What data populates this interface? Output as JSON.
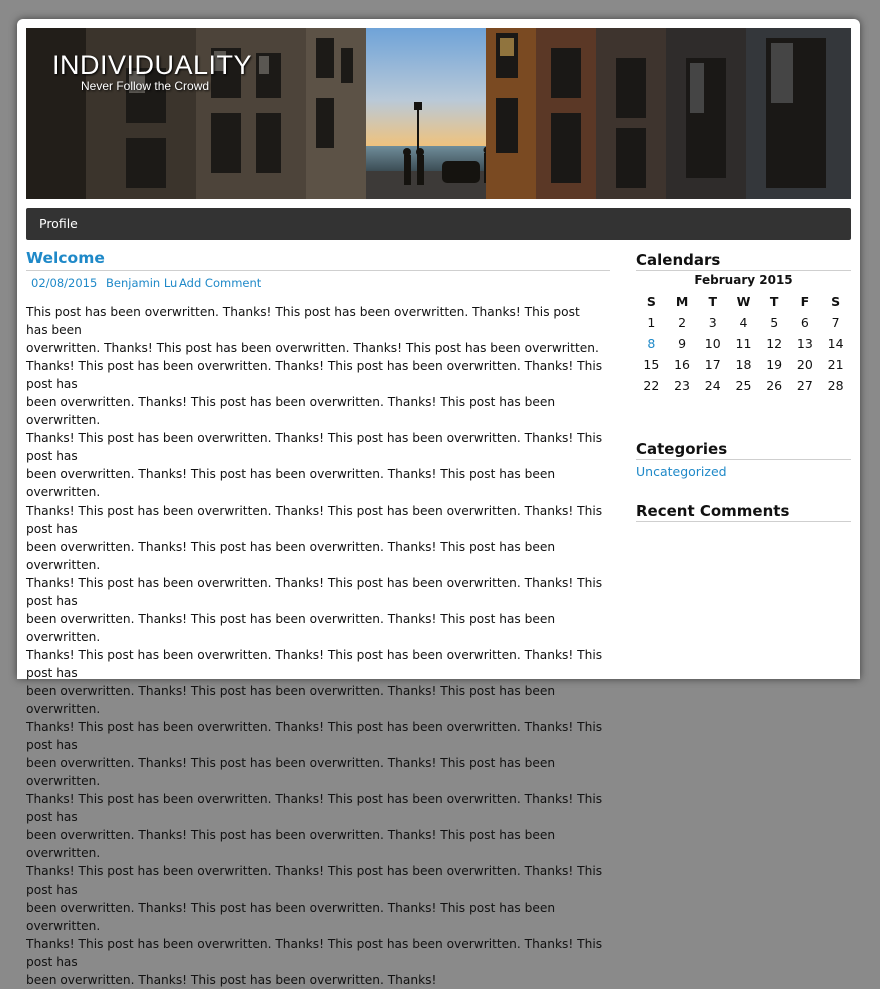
{
  "site": {
    "title": "INDIVIDUALITY",
    "tagline": "Never Follow the Crowd"
  },
  "nav": {
    "items": [
      {
        "label": "Profile"
      }
    ]
  },
  "post": {
    "title": "Welcome",
    "date": "02/08/2015",
    "author": "Benjamin Lu",
    "comment_link": "Add Comment",
    "lines": [
      "This post has been overwritten. Thanks! This post has been overwritten. Thanks! This post has been",
      "overwritten. Thanks! This post has been overwritten. Thanks! This post has been overwritten.",
      "Thanks! This post has been overwritten. Thanks! This post has been overwritten. Thanks! This post has",
      "been overwritten. Thanks! This post has been overwritten. Thanks! This post has been overwritten.",
      "Thanks! This post has been overwritten. Thanks! This post has been overwritten. Thanks! This post has",
      "been overwritten. Thanks! This post has been overwritten. Thanks! This post has been overwritten.",
      "Thanks! This post has been overwritten. Thanks! This post has been overwritten. Thanks! This post has",
      "been overwritten. Thanks! This post has been overwritten. Thanks! This post has been overwritten.",
      "Thanks! This post has been overwritten. Thanks! This post has been overwritten. Thanks! This post has",
      "been overwritten. Thanks! This post has been overwritten. Thanks! This post has been overwritten.",
      "Thanks! This post has been overwritten. Thanks! This post has been overwritten. Thanks! This post has",
      "been overwritten. Thanks! This post has been overwritten. Thanks! This post has been overwritten.",
      "Thanks! This post has been overwritten. Thanks! This post has been overwritten. Thanks! This post has",
      "been overwritten. Thanks! This post has been overwritten. Thanks! This post has been overwritten.",
      "Thanks! This post has been overwritten. Thanks! This post has been overwritten. Thanks! This post has",
      "been overwritten. Thanks! This post has been overwritten. Thanks! This post has been overwritten.",
      "Thanks! This post has been overwritten. Thanks! This post has been overwritten. Thanks! This post has",
      "been overwritten. Thanks! This post has been overwritten. Thanks! This post has been overwritten.",
      "Thanks! This post has been overwritten. Thanks! This post has been overwritten. Thanks! This post has",
      "been overwritten. Thanks! This post has been overwritten. Thanks!"
    ]
  },
  "sidebar": {
    "calendars": {
      "title": "Calendars",
      "month": "February 2015",
      "weekdays": [
        "S",
        "M",
        "T",
        "W",
        "T",
        "F",
        "S"
      ],
      "weeks": [
        [
          "1",
          "2",
          "3",
          "4",
          "5",
          "6",
          "7"
        ],
        [
          "8",
          "9",
          "10",
          "11",
          "12",
          "13",
          "14"
        ],
        [
          "15",
          "16",
          "17",
          "18",
          "19",
          "20",
          "21"
        ],
        [
          "22",
          "23",
          "24",
          "25",
          "26",
          "27",
          "28"
        ]
      ],
      "linked_day": "8"
    },
    "categories": {
      "title": "Categories",
      "items": [
        "Uncategorized"
      ]
    },
    "recent_comments": {
      "title": "Recent Comments"
    }
  },
  "colors": {
    "link": "#1f89c8",
    "nav_bg": "#333333",
    "page_bg": "#8a8a8a"
  }
}
